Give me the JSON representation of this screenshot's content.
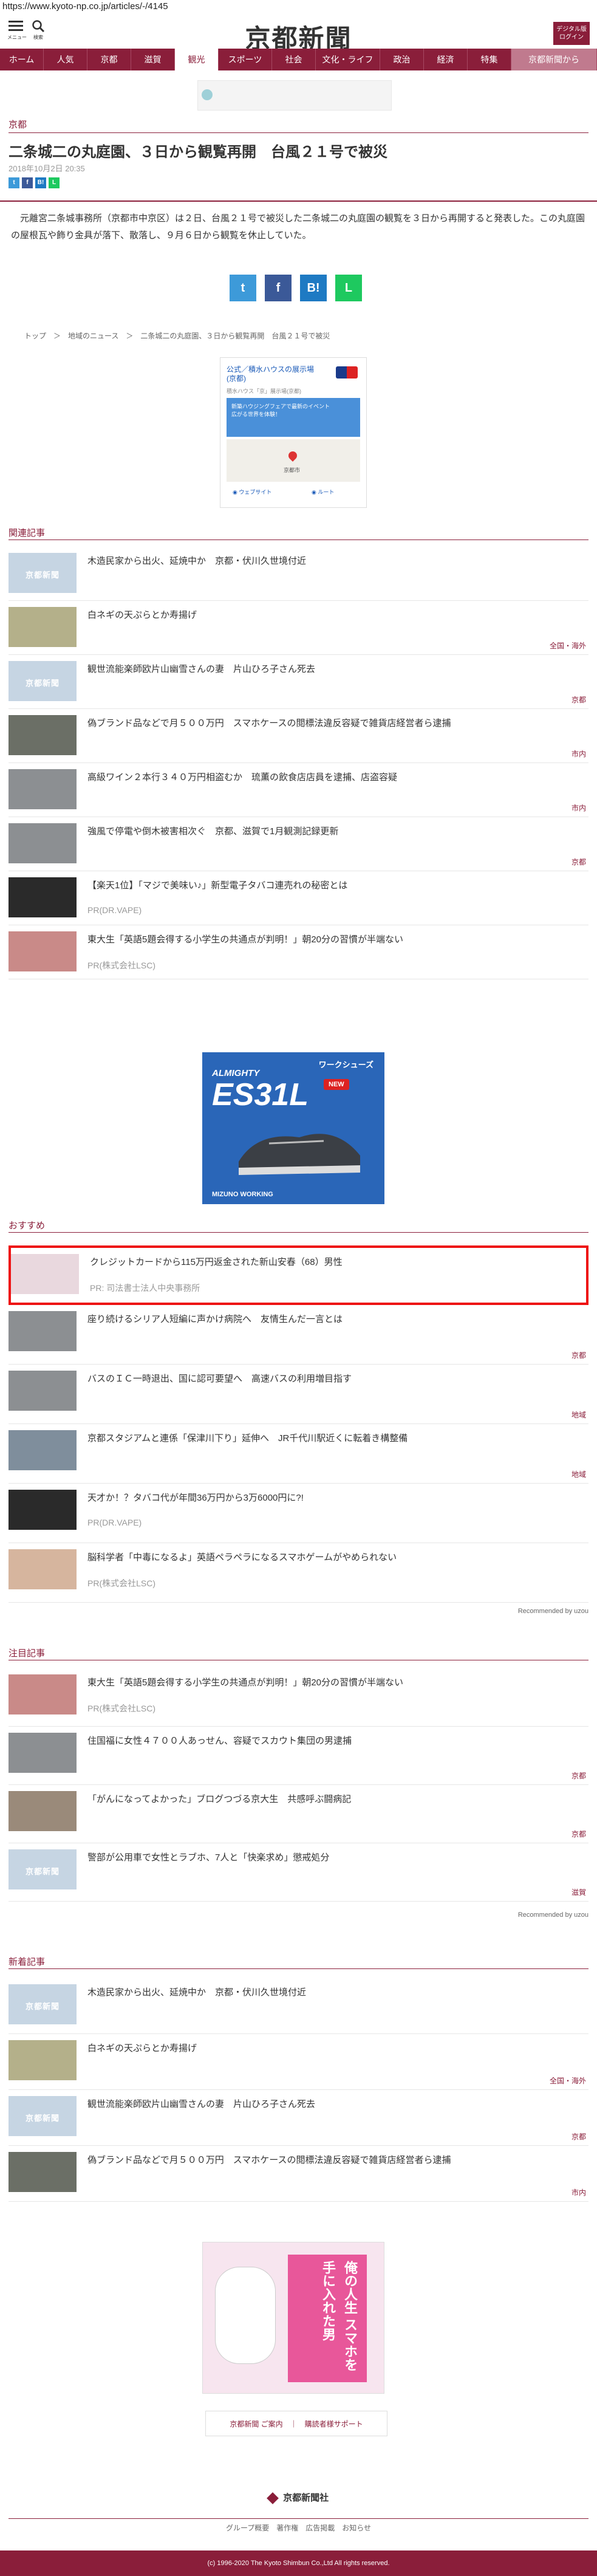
{
  "url": "https://www.kyoto-np.co.jp/articles/-/4145",
  "header": {
    "menu_label": "メニュー",
    "search_label": "検索",
    "logo": "京都新聞",
    "digital_label": "デジタル版\nログイン"
  },
  "nav": [
    {
      "label": "ホーム",
      "width": 72
    },
    {
      "label": "人気",
      "width": 72
    },
    {
      "label": "京都",
      "width": 72
    },
    {
      "label": "滋賀",
      "width": 72
    },
    {
      "label": "観光",
      "width": 72,
      "active": true
    },
    {
      "label": "スポーツ",
      "width": 88
    },
    {
      "label": "社会",
      "width": 72
    },
    {
      "label": "文化・ライフ",
      "width": 106
    },
    {
      "label": "政治",
      "width": 72
    },
    {
      "label": "経済",
      "width": 72
    },
    {
      "label": "特集",
      "width": 72
    },
    {
      "label": "京都新聞から",
      "width": 141,
      "last": true
    }
  ],
  "article": {
    "category": "京都",
    "title": "二条城二の丸庭園、３日から観覧再開　台風２１号で被災",
    "date": "2018年10月2日 20:35",
    "body": "　元離宮二条城事務所（京都市中京区）は２日、台風２１号で被災した二条城二の丸庭園の観覧を３日から再開すると発表した。この丸庭園の屋根瓦や飾り金具が落下、散落し、９月６日から観覧を休止していた。",
    "share": [
      "t",
      "f",
      "B!",
      "L"
    ]
  },
  "breadcrumb": "トップ　＞　地域のニュース　＞　二条城二の丸庭園、３日から観覧再開　台風２１号で被災",
  "map_ad": {
    "title": "公式／積水ハウスの展示場\n(京都)",
    "sub": "積水ハウス「京」展示場(京都)",
    "desc": "新築ハウジングフェアで最新のイベント\n広がる世界を体験！",
    "place": "京都市",
    "btn1": "ウェブサイト",
    "btn2": "ルート"
  },
  "related": {
    "title": "関連記事",
    "items": [
      {
        "title": "木造民家から出火、延焼中か　京都・伏川久世境付近",
        "tag": "",
        "thumb": "kyoto"
      },
      {
        "title": "白ネギの天ぷらとか寿揚げ",
        "tag": "全国・海外",
        "thumb": "food"
      },
      {
        "title": "観世流能楽師欧片山幽雪さんの妻　片山ひろ子さん死去",
        "tag": "京都",
        "thumb": "kyoto"
      },
      {
        "title": "偽ブランド品などで月５００万円　スマホケースの閲標法違反容疑で雑貨店経営者ら逮捕",
        "tag": "市内",
        "thumb": "goods"
      },
      {
        "title": "高級ワイン２本行３４０万円相盗むか　琉薫の飲食店店員を逮捕、店盗容疑",
        "tag": "市内",
        "thumb": "street"
      },
      {
        "title": "強風で停電や倒木被害相次ぐ　京都、滋賀で1月観測記録更新",
        "tag": "京都",
        "thumb": "street"
      },
      {
        "title": "【楽天1位】「マジで美味い♪」新型電子タバコ連売れの秘密とは",
        "tag": "",
        "pr": "PR(DR.VAPE)",
        "thumb": "device"
      },
      {
        "title": "東大生「英語5題会得する小学生の共通点が判明！」朝20分の習慣が半端ない",
        "tag": "",
        "pr": "PR(株式会社LSC)",
        "thumb": "girl"
      }
    ]
  },
  "mid_ad": {
    "top": "ワークシューズ",
    "brand": "ALMIGHTY",
    "model": "ES31L",
    "new": "NEW",
    "maker": "MIZUNO WORKING"
  },
  "recommend": {
    "title": "おすすめ",
    "items": [
      {
        "title": "クレジットカードから115万円返金された新山安春（68）男性",
        "pr": "PR: 司法書士法人中央事務所",
        "tag": "",
        "thumb": "pink",
        "highlight": true
      },
      {
        "title": "座り続けるシリア人短編に声かけ病院へ　友情生んだ一言とは",
        "tag": "京都",
        "thumb": "street"
      },
      {
        "title": "バスのＩＣ一時退出、国に認可要望へ　高速バスの利用増目指す",
        "tag": "地域",
        "thumb": "street"
      },
      {
        "title": "京都スタジアムと連係「保津川下り」延伸へ　JR千代川駅近くに転着き構整備",
        "tag": "地域",
        "thumb": "building"
      },
      {
        "title": "天才か！？タバコ代が年間36万円から3万6000円に?!",
        "pr": "PR(DR.VAPE)",
        "tag": "",
        "thumb": "device"
      },
      {
        "title": "脳科学者「中毒になるよ」英語ペラペラになるスマホゲームがやめられない",
        "pr": "PR(株式会社LSC)",
        "tag": "",
        "thumb": "face"
      }
    ],
    "powered": "Recommended by uzou"
  },
  "attention": {
    "title": "注目記事",
    "items": [
      {
        "title": "東大生「英語5題会得する小学生の共通点が判明！」朝20分の習慣が半端ない",
        "pr": "PR(株式会社LSC)",
        "tag": "",
        "thumb": "girl"
      },
      {
        "title": "住国福に女性４７００人あっせん、容疑でスカウト集団の男逮捕",
        "tag": "京都",
        "thumb": "street"
      },
      {
        "title": "「がんになってよかった」ブログつづる京大生　共感呼ぶ闘病記",
        "tag": "京都",
        "thumb": "people"
      },
      {
        "title": "警部が公用車で女性とラブホ、7人と「快楽求め」懲戒処分",
        "tag": "滋賀",
        "thumb": "kyoto"
      }
    ],
    "powered": "Recommended by uzou"
  },
  "latest": {
    "title": "新着記事",
    "items": [
      {
        "title": "木造民家から出火、延焼中か　京都・伏川久世境付近",
        "tag": "",
        "thumb": "kyoto"
      },
      {
        "title": "白ネギの天ぷらとか寿揚げ",
        "tag": "全国・海外",
        "thumb": "food"
      },
      {
        "title": "観世流能楽師欧片山幽雪さんの妻　片山ひろ子さん死去",
        "tag": "京都",
        "thumb": "kyoto"
      },
      {
        "title": "偽ブランド品などで月５００万円　スマホケースの閲標法違反容疑で雑貨店経営者ら逮捕",
        "tag": "市内",
        "thumb": "goods"
      }
    ]
  },
  "bottom_ad": {
    "text": "俺の人生 スマホを手に入れた男"
  },
  "footer_links": "京都新聞 ご案内　｜　購読者様サポート",
  "footer": {
    "logo": "京都新聞社",
    "nav": "グループ概要　著作権　広告掲載　お知らせ",
    "copyright": "(c) 1996-2020 The Kyoto Shimbun Co.,Ltd All rights reserved."
  },
  "kyoto_thumb_text": "京都新聞"
}
